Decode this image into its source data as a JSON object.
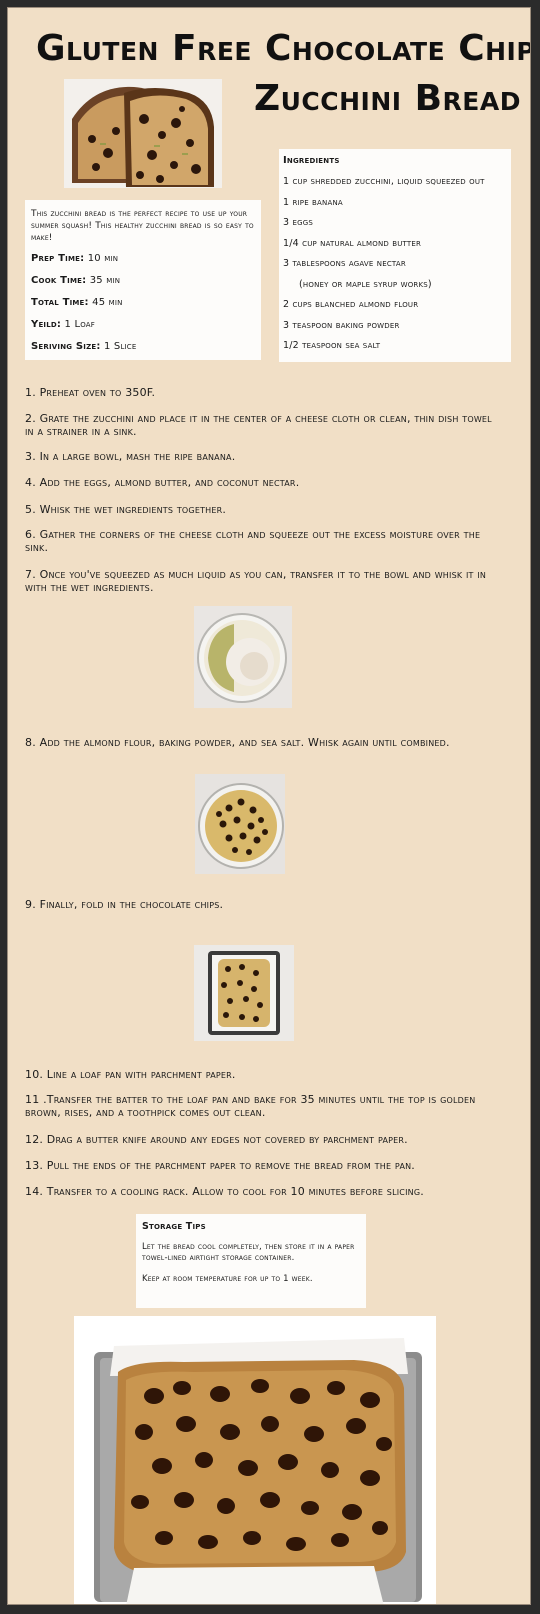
{
  "title": {
    "line1": "Gluten Free Chocolate Chip",
    "line2": "Zucchini Bread"
  },
  "intro": {
    "text": "This zucchini bread is the perfect recipe to use up your summer squash! This healthy zucchini bread is so easy to make!",
    "prep_label": "Prep Time:",
    "prep_value": "10 min",
    "cook_label": "Cook Time:",
    "cook_value": "35 min",
    "total_label": "Total Time:",
    "total_value": "45 min",
    "yield_label": "Yeild:",
    "yield_value": "1 Loaf",
    "serving_label": "Seriving Size:",
    "serving_value": "1 Slice"
  },
  "ingredients": {
    "heading": "Ingredients",
    "items": [
      "1 cup shredded zucchini, liquid squeezed out",
      "1 ripe banana",
      "3 eggs",
      "1/4 cup natural almond butter",
      "3 tablespoons agave nectar",
      "(honey or maple syrup works)",
      "2 cups blanched almond flour",
      "3 teaspoon baking powder",
      "1/2 teaspoon sea salt"
    ]
  },
  "steps": [
    "1. Preheat oven to 350F.",
    "2. Grate the zucchini and place it in the center of a cheese cloth or clean, thin dish towel in a strainer in a sink.",
    "3. In a large bowl, mash the ripe banana.",
    "4. Add the eggs, almond butter, and coconut nectar.",
    "5. Whisk the wet ingredients together.",
    "6. Gather the corners of the cheese cloth and squeeze out the excess moisture over the sink.",
    "7. Once you've squeezed as much liquid as you can, transfer it to the bowl and whisk it in with the wet ingredients.",
    "8. Add the almond flour, baking powder, and sea salt. Whisk again until combined.",
    "9. Finally, fold in the chocolate chips.",
    "10. Line a loaf pan with parchment paper.",
    "11 .Transfer the batter to the loaf pan and bake for 35 minutes until the top is golden brown, rises, and a toothpick comes out clean.",
    "12. Drag a butter knife around any edges not covered by parchment paper.",
    "13. Pull the ends of the parchment paper to remove the bread from the pan.",
    "14. Transfer to a cooling rack. Allow to cool for 10 minutes before slicing."
  ],
  "storage": {
    "heading": "Storage Tips",
    "tip1": "Let the bread cool completely, then store it in a paper towel-lined airtight storage container.",
    "tip2": "Keep at room temperature for up to 1 week."
  },
  "colors": {
    "background": "#f1dfc6",
    "card": "#fdfcfa",
    "text": "#1a1a1a"
  }
}
